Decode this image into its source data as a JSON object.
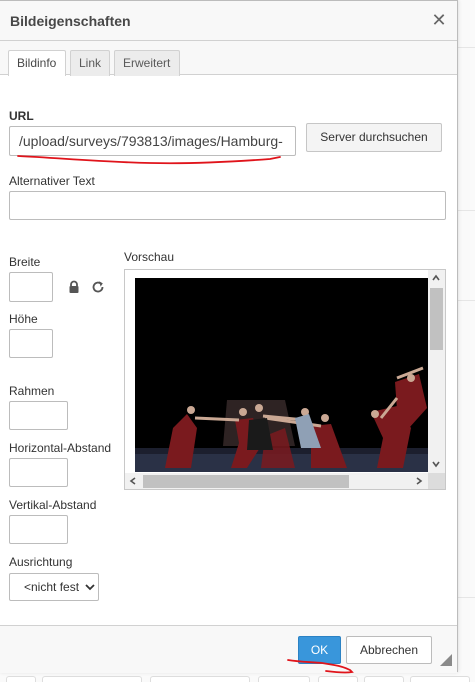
{
  "dialog": {
    "title": "Bildeigenschaften",
    "close_icon": "close-icon"
  },
  "tabs": [
    {
      "label": "Bildinfo",
      "active": true
    },
    {
      "label": "Link",
      "active": false
    },
    {
      "label": "Erweitert",
      "active": false
    }
  ],
  "url": {
    "label": "URL",
    "value": "/upload/surveys/793813/images/Hamburg-",
    "browse_label": "Server durchsuchen"
  },
  "alt_text": {
    "label": "Alternativer Text",
    "value": ""
  },
  "width": {
    "label": "Breite",
    "value": ""
  },
  "height": {
    "label": "Höhe",
    "value": ""
  },
  "lock_icon": "lock-icon",
  "reset_icon": "reset-size-icon",
  "border": {
    "label": "Rahmen",
    "value": ""
  },
  "hspace": {
    "label": "Horizontal-Abstand",
    "value": ""
  },
  "vspace": {
    "label": "Vertikal-Abstand",
    "value": ""
  },
  "align": {
    "label": "Ausrichtung",
    "selected": "<nicht fest"
  },
  "preview": {
    "label": "Vorschau"
  },
  "footer": {
    "ok_label": "OK",
    "cancel_label": "Abbrechen"
  },
  "colors": {
    "accent": "#3996db",
    "annotation": "#e0141b"
  }
}
